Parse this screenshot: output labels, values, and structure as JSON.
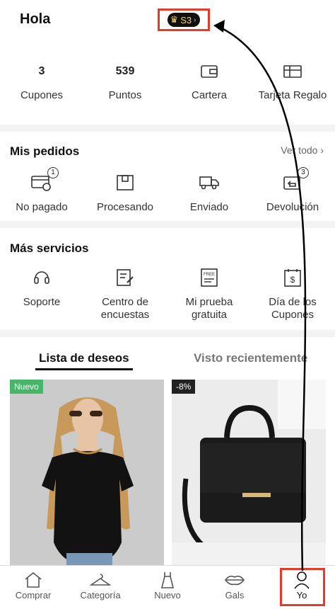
{
  "header": {
    "greeting": "Hola",
    "vip_level": "S3"
  },
  "stats": [
    {
      "value": "3",
      "label": "Cupones"
    },
    {
      "value": "539",
      "label": "Puntos"
    },
    {
      "value": "",
      "label": "Cartera",
      "icon": "wallet-icon"
    },
    {
      "value": "",
      "label": "Tarjeta Regalo",
      "icon": "gift-card-icon"
    }
  ],
  "orders": {
    "title": "Mis pedidos",
    "view_all": "Ver todo",
    "items": [
      {
        "label": "No pagado",
        "icon": "unpaid-icon",
        "badge": "1"
      },
      {
        "label": "Procesando",
        "icon": "box-icon",
        "badge": ""
      },
      {
        "label": "Enviado",
        "icon": "truck-icon",
        "badge": ""
      },
      {
        "label": "Devolución",
        "icon": "return-icon",
        "badge": "3"
      }
    ]
  },
  "services": {
    "title": "Más servicios",
    "items": [
      {
        "line1": "Soporte",
        "line2": "",
        "icon": "headset-icon"
      },
      {
        "line1": "Centro de",
        "line2": "encuestas",
        "icon": "survey-icon"
      },
      {
        "line1": "Mi prueba",
        "line2": "gratuita",
        "icon": "free-trial-icon"
      },
      {
        "line1": "Día de los",
        "line2": "Cupones",
        "icon": "coupon-day-icon"
      }
    ]
  },
  "tabs": {
    "wishlist": "Lista de deseos",
    "recent": "Visto recientemente"
  },
  "products": [
    {
      "tag": "Nuevo",
      "tag_color": "#49b56b"
    },
    {
      "tag": "-8%",
      "tag_color": "#222222"
    }
  ],
  "nav": [
    {
      "label": "Comprar",
      "icon": "home-icon"
    },
    {
      "label": "Categoría",
      "icon": "hanger-icon"
    },
    {
      "label": "Nuevo",
      "icon": "dress-icon"
    },
    {
      "label": "Gals",
      "icon": "lips-icon"
    },
    {
      "label": "Yo",
      "icon": "person-icon"
    }
  ],
  "colors": {
    "highlight": "#e53b2a",
    "arrow": "#000000"
  }
}
